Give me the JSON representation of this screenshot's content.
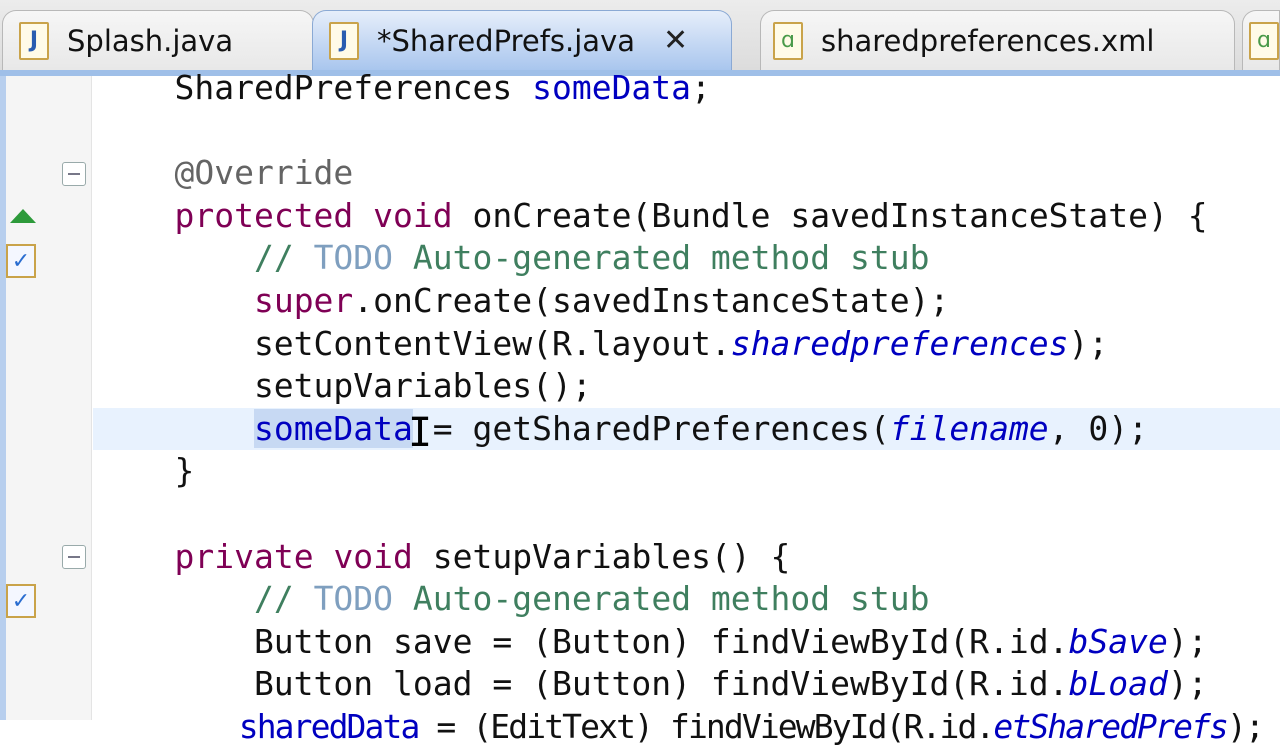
{
  "tabs": [
    {
      "label": "Splash.java",
      "icon": "J",
      "type": "java"
    },
    {
      "label": "*SharedPrefs.java",
      "icon": "J",
      "type": "java",
      "active": true,
      "close": "✕"
    },
    {
      "label": "sharedpreferences.xml",
      "icon": "ɑ",
      "type": "xml"
    },
    {
      "label": "",
      "icon": "ɑ",
      "type": "xml"
    }
  ],
  "gutter": {
    "task_icon": "✓"
  },
  "code": [
    [
      {
        "t": "    SharedPreferences "
      },
      {
        "t": "someData",
        "c": "fld"
      },
      {
        "t": ";"
      }
    ],
    [],
    [
      {
        "t": "    "
      },
      {
        "t": "@Override",
        "c": "ann"
      }
    ],
    [
      {
        "t": "    "
      },
      {
        "t": "protected",
        "c": "kw"
      },
      {
        "t": " "
      },
      {
        "t": "void",
        "c": "kw"
      },
      {
        "t": " onCreate(Bundle savedInstanceState) {"
      }
    ],
    [
      {
        "t": "        "
      },
      {
        "t": "// ",
        "c": "cmt"
      },
      {
        "t": "TODO",
        "c": "todo"
      },
      {
        "t": " Auto-generated method stub",
        "c": "cmt"
      }
    ],
    [
      {
        "t": "        "
      },
      {
        "t": "super",
        "c": "kw"
      },
      {
        "t": ".onCreate(savedInstanceState);"
      }
    ],
    [
      {
        "t": "        setContentView(R.layout."
      },
      {
        "t": "sharedpreferences",
        "c": "ital"
      },
      {
        "t": ");"
      }
    ],
    [
      {
        "t": "        setupVariables();"
      }
    ],
    [
      {
        "t": "        "
      },
      {
        "t": "someData",
        "c": "fld sel"
      },
      {
        "t": " = getSharedPreferences("
      },
      {
        "t": "filename",
        "c": "ital"
      },
      {
        "t": ", 0);"
      }
    ],
    [
      {
        "t": "    }"
      }
    ],
    [],
    [
      {
        "t": "    "
      },
      {
        "t": "private",
        "c": "kw"
      },
      {
        "t": " "
      },
      {
        "t": "void",
        "c": "kw"
      },
      {
        "t": " setupVariables() {"
      }
    ],
    [
      {
        "t": "        "
      },
      {
        "t": "// ",
        "c": "cmt"
      },
      {
        "t": "TODO",
        "c": "todo"
      },
      {
        "t": " Auto-generated method stub",
        "c": "cmt"
      }
    ],
    [
      {
        "t": "        Button save = (Button) findViewById(R.id."
      },
      {
        "t": "bSave",
        "c": "ital"
      },
      {
        "t": ");"
      }
    ],
    [
      {
        "t": "        Button load = (Button) findViewById(R.id."
      },
      {
        "t": "bLoad",
        "c": "ital"
      },
      {
        "t": ");"
      }
    ],
    [
      {
        "t": "        "
      },
      {
        "t": "sharedData",
        "c": "fld"
      },
      {
        "t": " = (EditText) findViewById(R.id."
      },
      {
        "t": "etSharedPrefs",
        "c": "ital"
      },
      {
        "t": ");"
      }
    ]
  ],
  "current_line": 8,
  "cursor": "I"
}
